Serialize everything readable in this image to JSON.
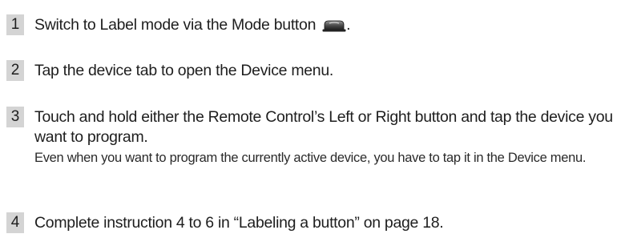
{
  "steps": [
    {
      "number": "1",
      "text": "Switch to Label mode via the Mode button",
      "trailing": ".",
      "icon": "mode-button-icon"
    },
    {
      "number": "2",
      "text": "Tap the device tab to open the Device menu."
    },
    {
      "number": "3",
      "text": "Touch and hold either the Remote Control’s Left or Right button and tap the device you want to program.",
      "note": "Even when you want to program the currently active device, you have to tap it in the Device menu."
    },
    {
      "number": "4",
      "text": "Complete instruction 4 to 6 in “Labeling a button” on page 18."
    }
  ]
}
